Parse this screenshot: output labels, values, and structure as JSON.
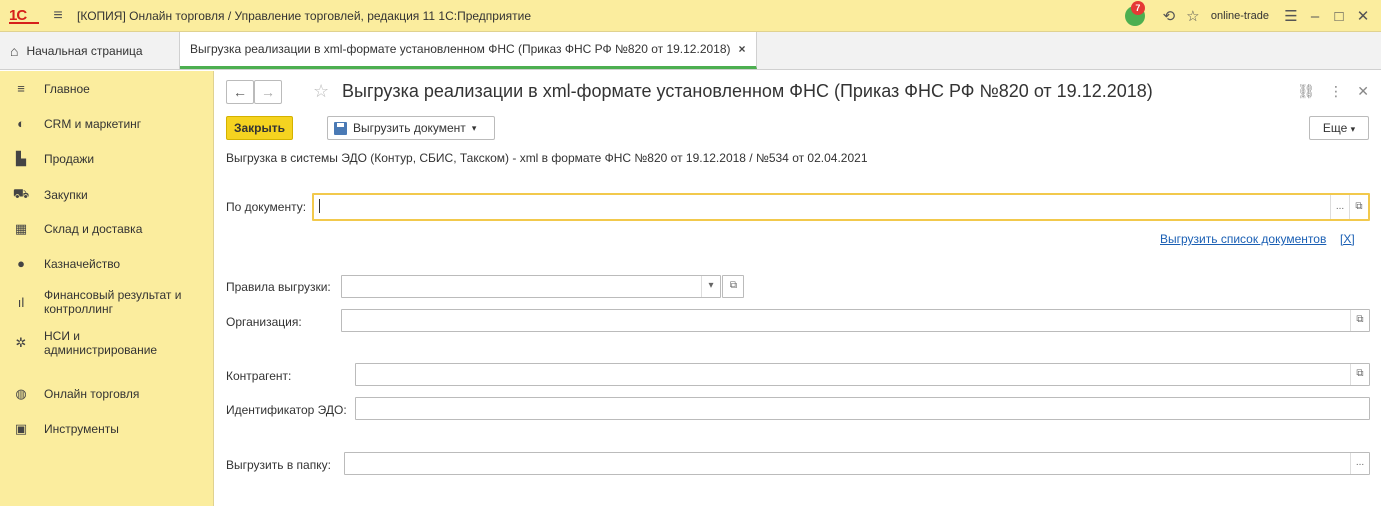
{
  "window": {
    "title": "[КОПИЯ] Онлайн торговля / Управление торговлей, редакция 11 1С:Предприятие",
    "logo": "1С",
    "user": "online-trade",
    "notifications": "7"
  },
  "tabs": {
    "home": "Начальная страница",
    "active": "Выгрузка реализации в xml-формате установленном ФНС (Приказ ФНС РФ №820 от 19.12.2018)",
    "close": "×"
  },
  "sidebar": {
    "items": [
      {
        "label": "Главное",
        "icon": "≡"
      },
      {
        "label": "CRM и маркетинг",
        "icon": "◐"
      },
      {
        "label": "Продажи",
        "icon": "▙"
      },
      {
        "label": "Закупки",
        "icon": "⛟"
      },
      {
        "label": "Склад и доставка",
        "icon": "▦"
      },
      {
        "label": "Казначейство",
        "icon": "●"
      },
      {
        "label": "Финансовый результат и контроллинг",
        "icon": "ıl"
      },
      {
        "label": "НСИ и администрирование",
        "icon": "✲"
      },
      {
        "label": "Онлайн торговля",
        "icon": "◍"
      },
      {
        "label": "Инструменты",
        "icon": "▣"
      }
    ]
  },
  "form": {
    "title": "Выгрузка реализации в xml-формате установленном ФНС (Приказ ФНС РФ №820 от 19.12.2018)",
    "close_button": "Закрыть",
    "export_button": "Выгрузить документ",
    "more_button": "Еще",
    "subtitle": "Выгрузка в системы ЭДО (Контур, СБИС, Такском) - xml в формате ФНС №820 от 19.12.2018 / №534 от 02.04.2021",
    "by_document_label": "По документу:",
    "by_document_value": "",
    "export_list_link": "Выгрузить список документов",
    "export_list_close": "[X]",
    "rules_label": "Правила выгрузки:",
    "rules_value": "",
    "organization_label": "Организация:",
    "organization_value": "",
    "counterparty_label": "Контрагент:",
    "counterparty_value": "",
    "edo_id_label": "Идентификатор ЭДО:",
    "edo_id_value": "",
    "export_folder_label": "Выгрузить в папку:",
    "export_folder_value": ""
  },
  "colors": {
    "accent_yellow": "#fbed9e",
    "primary_button": "#f5d320",
    "active_tab_underline": "#4caf50",
    "link": "#1a5fb4"
  }
}
